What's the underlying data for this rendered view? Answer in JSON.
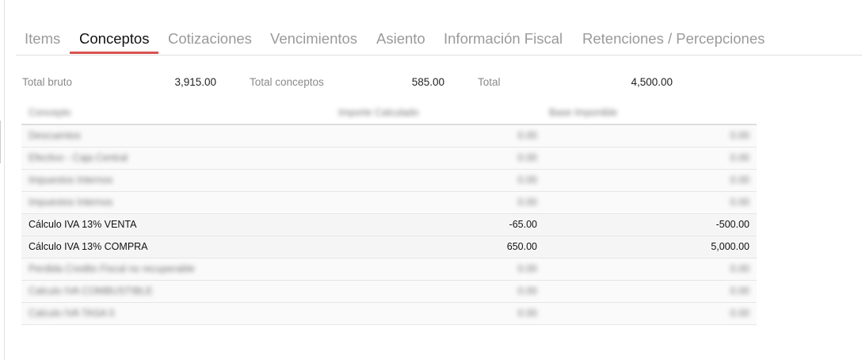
{
  "tabs": [
    {
      "label": "Items"
    },
    {
      "label": "Conceptos"
    },
    {
      "label": "Cotizaciones"
    },
    {
      "label": "Vencimientos"
    },
    {
      "label": "Asiento"
    },
    {
      "label": "Información Fiscal"
    },
    {
      "label": "Retenciones / Percepciones"
    }
  ],
  "active_tab": "Conceptos",
  "totals": {
    "bruto_label": "Total bruto",
    "bruto_value": "3,915.00",
    "conceptos_label": "Total conceptos",
    "conceptos_value": "585.00",
    "total_label": "Total",
    "total_value": "4,500.00"
  },
  "grid": {
    "headers": [
      "Concepto",
      "Importe Calculado",
      "Base Imponible"
    ],
    "rows": [
      {
        "concepto": "Descuentos",
        "importe": "0.00",
        "base": "0.00",
        "blurred": true
      },
      {
        "concepto": "Efectivo - Caja Central",
        "importe": "0.00",
        "base": "0.00",
        "blurred": true
      },
      {
        "concepto": "Impuestos Internos",
        "importe": "0.00",
        "base": "0.00",
        "blurred": true
      },
      {
        "concepto": "Impuestos Internos",
        "importe": "0.00",
        "base": "0.00",
        "blurred": true
      },
      {
        "concepto": "Cálculo IVA 13% VENTA",
        "importe": "-65.00",
        "base": "-500.00",
        "blurred": false
      },
      {
        "concepto": "Cálculo IVA 13% COMPRA",
        "importe": "650.00",
        "base": "5,000.00",
        "blurred": false
      },
      {
        "concepto": "Perdida Credito Fiscal no recuperable",
        "importe": "0.00",
        "base": "0.00",
        "blurred": true
      },
      {
        "concepto": "Calculo IVA COMBUSTIBLE",
        "importe": "0.00",
        "base": "0.00",
        "blurred": true
      },
      {
        "concepto": "Calculo IVA TASA 0",
        "importe": "0.00",
        "base": "0.00",
        "blurred": true
      }
    ]
  }
}
